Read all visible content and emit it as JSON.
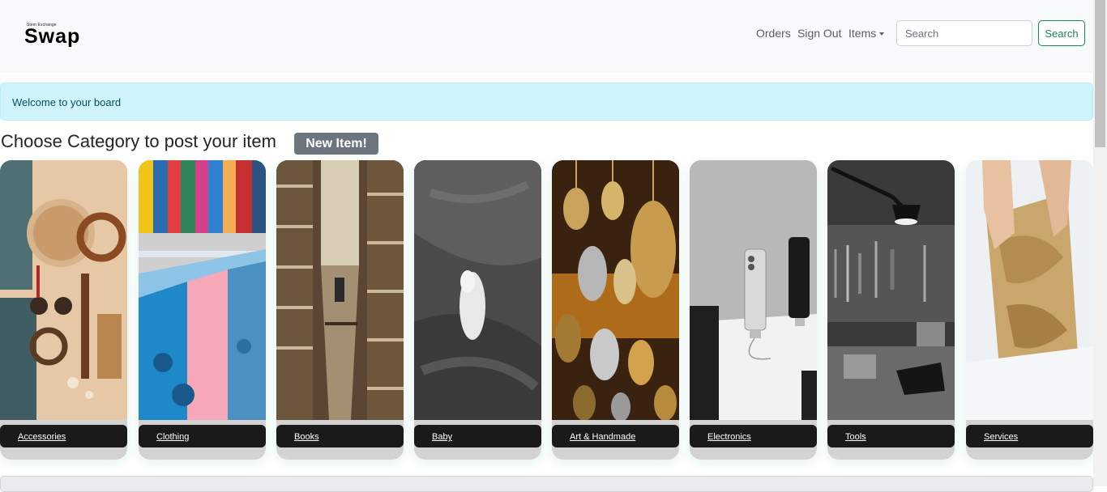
{
  "brand": {
    "tagline": "Stem Exchange",
    "name": "Swap"
  },
  "nav": {
    "orders": "Orders",
    "sign_out": "Sign Out",
    "items": "Items",
    "search_placeholder": "Search",
    "search_button": "Search"
  },
  "alert": {
    "text": "Welcome to your board"
  },
  "main": {
    "heading": "Choose Category to post your item",
    "new_item": "New Item!"
  },
  "categories": [
    {
      "label": "Accessories"
    },
    {
      "label": "Clothing"
    },
    {
      "label": "Books"
    },
    {
      "label": "Baby"
    },
    {
      "label": "Art & Handmade"
    },
    {
      "label": "Electronics"
    },
    {
      "label": "Tools"
    },
    {
      "label": "Services"
    }
  ],
  "colors": {
    "navbar_bg": "#f8f9fa",
    "alert_bg": "#cff4fc",
    "alert_text": "#055160",
    "search_btn": "#198754",
    "new_item_bg": "#6c757d",
    "card_label_bg": "#1a1a1a"
  }
}
